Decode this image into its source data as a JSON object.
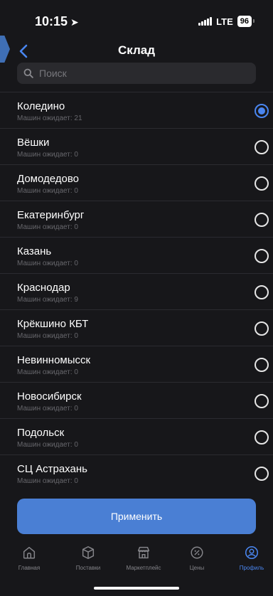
{
  "status_bar": {
    "time": "10:15",
    "network": "LTE",
    "battery": "96"
  },
  "header": {
    "title": "Склад"
  },
  "search": {
    "placeholder": "Поиск",
    "value": ""
  },
  "warehouses": [
    {
      "name": "Коледино",
      "waiting": "Машин ожидает: 21",
      "selected": true
    },
    {
      "name": "Вёшки",
      "waiting": "Машин ожидает: 0",
      "selected": false
    },
    {
      "name": "Домодедово",
      "waiting": "Машин ожидает: 0",
      "selected": false
    },
    {
      "name": "Екатеринбург",
      "waiting": "Машин ожидает: 0",
      "selected": false
    },
    {
      "name": "Казань",
      "waiting": "Машин ожидает: 0",
      "selected": false
    },
    {
      "name": "Краснодар",
      "waiting": "Машин ожидает: 9",
      "selected": false
    },
    {
      "name": "Крёкшино КБТ",
      "waiting": "Машин ожидает: 0",
      "selected": false
    },
    {
      "name": "Невинномысск",
      "waiting": "Машин ожидает: 0",
      "selected": false
    },
    {
      "name": "Новосибирск",
      "waiting": "Машин ожидает: 0",
      "selected": false
    },
    {
      "name": "Подольск",
      "waiting": "Машин ожидает: 0",
      "selected": false
    },
    {
      "name": "СЦ Астрахань",
      "waiting": "Машин ожидает: 0",
      "selected": false
    }
  ],
  "apply_label": "Применить",
  "tabs": [
    {
      "label": "Главная",
      "icon": "home-icon"
    },
    {
      "label": "Поставки",
      "icon": "box-icon"
    },
    {
      "label": "Маркетплейс",
      "icon": "store-icon"
    },
    {
      "label": "Цены",
      "icon": "percent-icon"
    },
    {
      "label": "Профиль",
      "icon": "profile-icon",
      "active": true
    }
  ],
  "colors": {
    "accent": "#4a86f0",
    "button": "#4a7fd4",
    "background": "#17171a",
    "edge_arrow": "#3f6fb5"
  }
}
